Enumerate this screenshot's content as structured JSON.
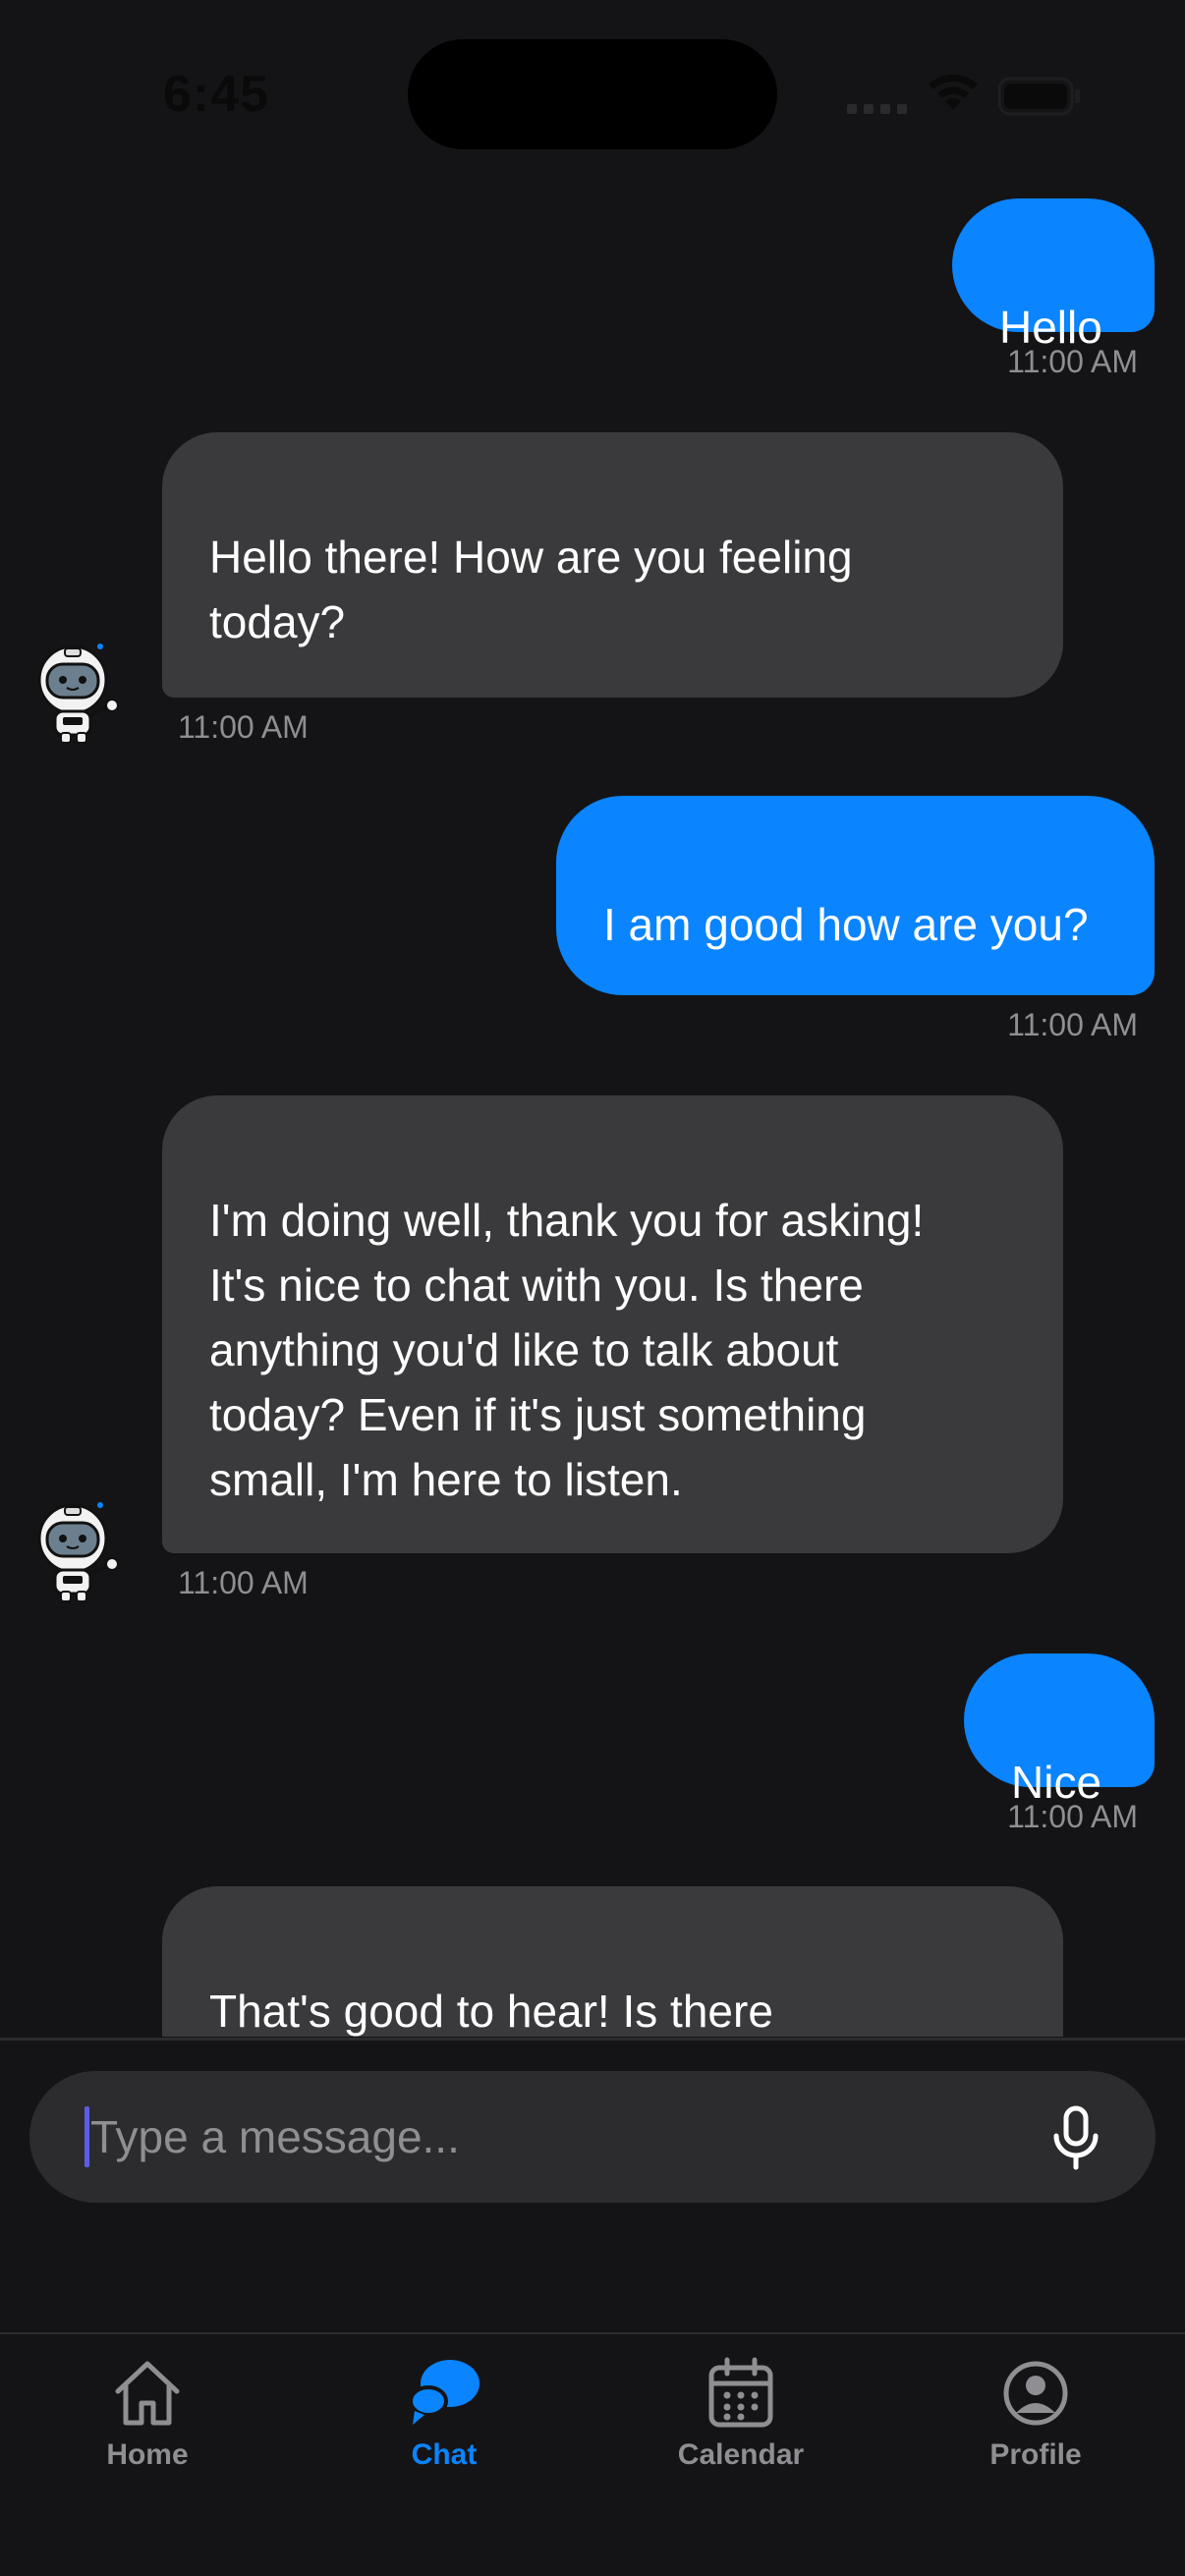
{
  "status_bar": {
    "time": "6:45"
  },
  "messages": [
    {
      "sender": "user",
      "text": "Hello",
      "time": "11:00 AM"
    },
    {
      "sender": "bot",
      "text": "Hello there!  How are you feeling\ntoday?",
      "time": "11:00 AM"
    },
    {
      "sender": "user",
      "text": "I am good how are you?",
      "time": "11:00 AM"
    },
    {
      "sender": "bot",
      "text": "I'm doing well, thank you for asking!\nIt's nice to chat with you. Is there\nanything you'd like to talk about\ntoday?  Even if it's just something\nsmall, I'm here to listen.",
      "time": "11:00 AM"
    },
    {
      "sender": "user",
      "text": "Nice",
      "time": "11:00 AM"
    },
    {
      "sender": "bot",
      "text": "That's good to hear!  Is there\nanything else you'd like to share or"
    }
  ],
  "input": {
    "placeholder": "Type a message...",
    "value": ""
  },
  "tabs": [
    {
      "label": "Home",
      "icon": "home-icon",
      "active": false
    },
    {
      "label": "Chat",
      "icon": "chat-icon",
      "active": true
    },
    {
      "label": "Calendar",
      "icon": "calendar-icon",
      "active": false
    },
    {
      "label": "Profile",
      "icon": "profile-icon",
      "active": false
    }
  ],
  "colors": {
    "background": "#141416",
    "user_bubble": "#0a84ff",
    "bot_bubble": "#3a3a3c",
    "accent": "#0a84ff",
    "muted": "#8e8e93"
  }
}
